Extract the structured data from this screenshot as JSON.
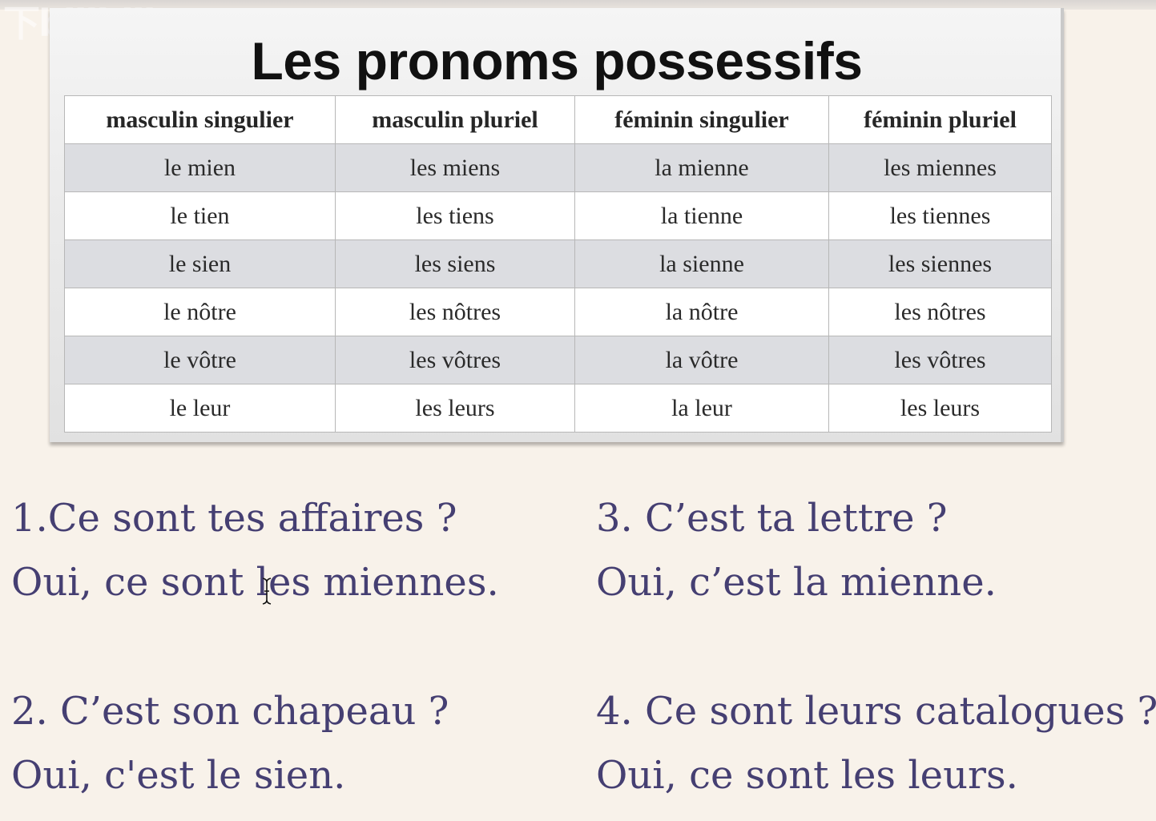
{
  "watermark": "下bilibili",
  "slide": {
    "title": "Les pronoms possessifs",
    "table": {
      "headers": [
        "masculin singulier",
        "masculin pluriel",
        "féminin singulier",
        "féminin pluriel"
      ],
      "rows": [
        [
          "le mien",
          "les miens",
          "la mienne",
          "les miennes"
        ],
        [
          "le tien",
          "les tiens",
          "la tienne",
          "les tiennes"
        ],
        [
          "le sien",
          "les siens",
          "la sienne",
          "les siennes"
        ],
        [
          "le nôtre",
          "les nôtres",
          "la nôtre",
          "les nôtres"
        ],
        [
          "le vôtre",
          "les vôtres",
          "la vôtre",
          "les vôtres"
        ],
        [
          "le leur",
          "les leurs",
          "la leur",
          "les leurs"
        ]
      ]
    }
  },
  "exercises": [
    {
      "question": "1.Ce sont tes affaires ?",
      "answer": "Oui, ce sont les miennes."
    },
    {
      "question": "2. C’est son chapeau ?",
      "answer": "Oui, c'est le sien."
    },
    {
      "question": "3. C’est ta lettre ?",
      "answer": "Oui, c’est la mienne."
    },
    {
      "question": "4. Ce sont leurs catalogues ?",
      "answer": "Oui, ce sont les leurs."
    }
  ],
  "colors": {
    "background": "#f8f2ea",
    "exercise_text": "#453f72",
    "shaded_row": "#dcdde1"
  }
}
